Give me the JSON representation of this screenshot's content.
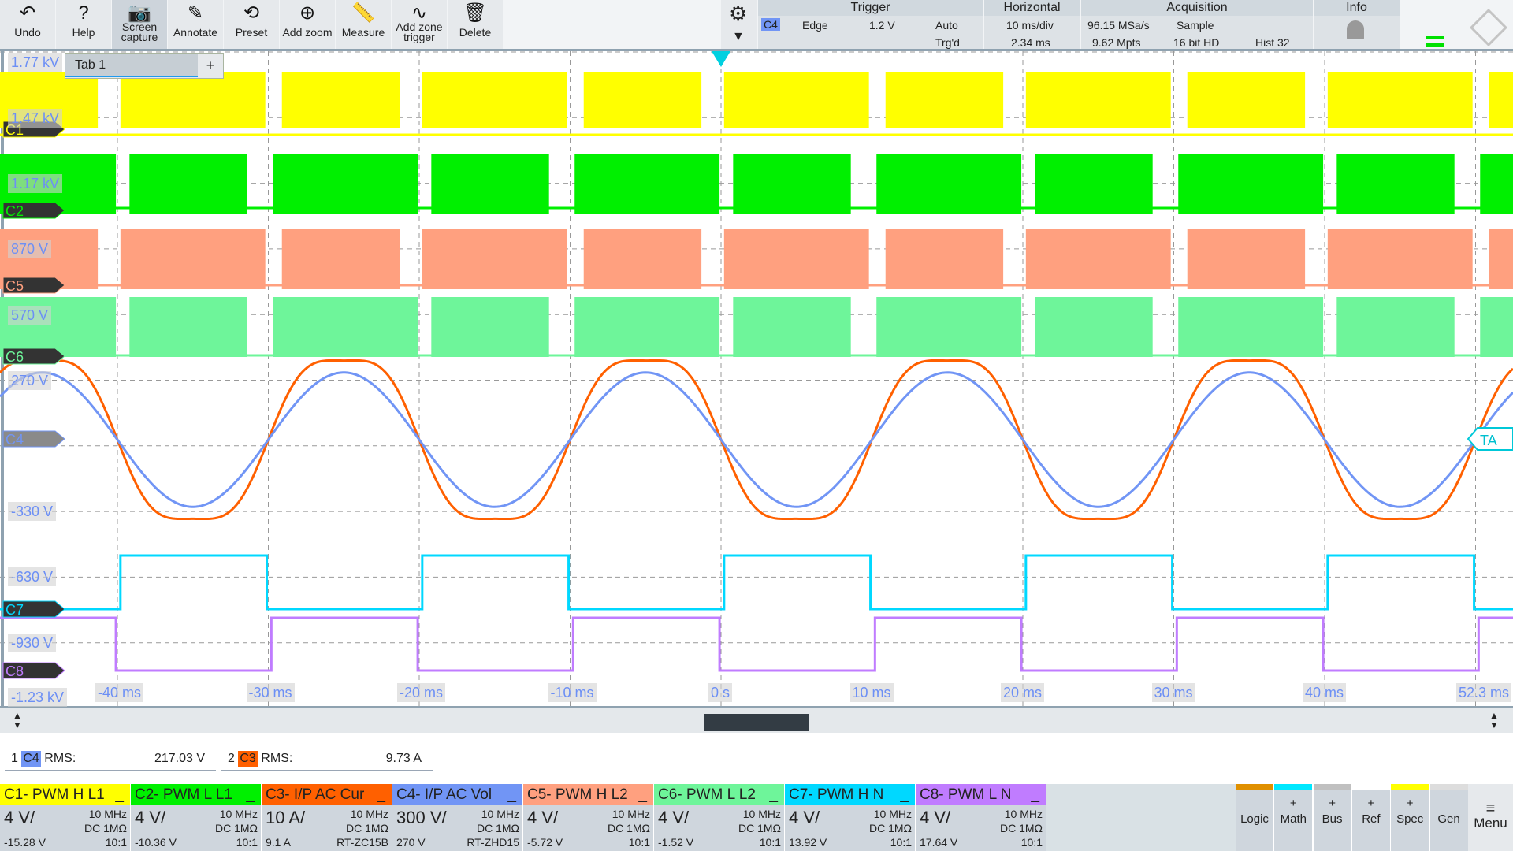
{
  "toolbar": {
    "items": [
      {
        "label": "Undo",
        "icon": "undo-icon",
        "glyph": "↶"
      },
      {
        "label": "Help",
        "icon": "help-icon",
        "glyph": "?"
      },
      {
        "label": "Screen capture",
        "icon": "camera-icon",
        "glyph": "📷"
      },
      {
        "label": "Annotate",
        "icon": "pencil-icon",
        "glyph": "✎"
      },
      {
        "label": "Preset",
        "icon": "preset-icon",
        "glyph": "⟲"
      },
      {
        "label": "Add zoom",
        "icon": "zoom-in-icon",
        "glyph": "⊕"
      },
      {
        "label": "Measure",
        "icon": "ruler-icon",
        "glyph": "📏"
      },
      {
        "label": "Add zone trigger",
        "icon": "zone-trigger-icon",
        "glyph": "∿"
      },
      {
        "label": "Delete",
        "icon": "trash-icon",
        "glyph": "🗑"
      }
    ]
  },
  "trigger": {
    "title": "Trigger",
    "source": "C4",
    "type": "Edge",
    "level": "1.2 V",
    "mode": "Auto",
    "state": "Trg'd"
  },
  "horizontal": {
    "title": "Horizontal",
    "scale": "10 ms/div",
    "position": "2.34 ms"
  },
  "acquisition": {
    "title": "Acquisition",
    "rate": "96.15 MSa/s",
    "points": "9.62 Mpts",
    "mode": "Sample",
    "resolution": "16 bit HD",
    "history": "Hist 32"
  },
  "info": {
    "title": "Info"
  },
  "tabs": [
    {
      "label": "Tab 1"
    }
  ],
  "tab_add": "+",
  "trigger_marker": "TA",
  "chart_data": {
    "type": "line",
    "x_unit": "ms",
    "xlim": [
      -47.7,
      52.3
    ],
    "x_ticks": [
      "-40 ms",
      "-30 ms",
      "-20 ms",
      "-10 ms",
      "0 s",
      "10 ms",
      "20 ms",
      "30 ms",
      "40 ms",
      "52.3 ms"
    ],
    "y_ticks": [
      "1.77 kV",
      "1.47 kV",
      "1.17 kV",
      "870 V",
      "570 V",
      "270 V",
      "-330 V",
      "-630 V",
      "-930 V",
      "-1.23 kV"
    ],
    "grid": true,
    "channels": [
      {
        "id": "C1",
        "color": "#ffff00",
        "kind": "pwm",
        "period_ms": 20,
        "high_ms": [
          [
            0.2,
            9.8
          ],
          [
            10.9,
            18.7
          ]
        ]
      },
      {
        "id": "C2",
        "color": "#00f000",
        "kind": "pwm",
        "period_ms": 20,
        "high_ms": [
          [
            0.8,
            8.6
          ],
          [
            10.3,
            19.9
          ]
        ]
      },
      {
        "id": "C5",
        "color": "#ffa07f",
        "kind": "pwm",
        "period_ms": 20,
        "high_ms": [
          [
            0.2,
            9.8
          ],
          [
            10.9,
            18.7
          ]
        ]
      },
      {
        "id": "C6",
        "color": "#6ef59a",
        "kind": "pwm",
        "period_ms": 20,
        "high_ms": [
          [
            0.8,
            8.6
          ],
          [
            10.3,
            19.9
          ]
        ]
      },
      {
        "id": "C3",
        "color": "#ff6000",
        "kind": "sine",
        "freq_hz": 50,
        "peak": 13.7,
        "unit": "A",
        "zero_cross_falling_ms": -40
      },
      {
        "id": "C4",
        "color": "#7195f5",
        "kind": "sine",
        "freq_hz": 50,
        "peak": 307,
        "unit": "V",
        "zero_cross_falling_ms": -40
      },
      {
        "id": "C7",
        "color": "#00d8ff",
        "kind": "pulse",
        "period_ms": 20,
        "high_ms": [
          [
            0.2,
            9.9
          ]
        ]
      },
      {
        "id": "C8",
        "color": "#c07cff",
        "kind": "pulse",
        "period_ms": 20,
        "high_ms": [
          [
            10.2,
            19.9
          ]
        ]
      }
    ]
  },
  "measurements": [
    {
      "index": "1",
      "source": "C4",
      "source_color": "#7195f5",
      "name": "RMS:",
      "value": "217.03 V"
    },
    {
      "index": "2",
      "source": "C3",
      "source_color": "#ff6000",
      "name": "RMS:",
      "value": "9.73 A"
    }
  ],
  "channel_boxes": [
    {
      "title": "C1- PWM H L1",
      "color": "#ffff00",
      "scale": "4 V/",
      "bw": "10 MHz",
      "coupling": "DC 1MΩ",
      "offset": "-15.28 V",
      "probe": "10:1"
    },
    {
      "title": "C2- PWM L L1",
      "color": "#00f000",
      "scale": "4 V/",
      "bw": "10 MHz",
      "coupling": "DC 1MΩ",
      "offset": "-10.36 V",
      "probe": "10:1"
    },
    {
      "title": "C3- I/P AC Cur",
      "color": "#ff6000",
      "scale": "10 A/",
      "bw": "10 MHz",
      "coupling": "DC 1MΩ",
      "offset": "9.1 A",
      "probe": "RT-ZC15B"
    },
    {
      "title": "C4- I/P AC Vol",
      "color": "#7195f5",
      "scale": "300 V/",
      "bw": "10 MHz",
      "coupling": "DC 1MΩ",
      "offset": "270 V",
      "probe": "RT-ZHD15"
    },
    {
      "title": "C5- PWM H L2",
      "color": "#ffa07f",
      "scale": "4 V/",
      "bw": "10 MHz",
      "coupling": "DC 1MΩ",
      "offset": "-5.72 V",
      "probe": "10:1"
    },
    {
      "title": "C6- PWM L L2",
      "color": "#6ef59a",
      "scale": "4 V/",
      "bw": "10 MHz",
      "coupling": "DC 1MΩ",
      "offset": "-1.52 V",
      "probe": "10:1"
    },
    {
      "title": "C7- PWM H N",
      "color": "#00d8ff",
      "scale": "4 V/",
      "bw": "10 MHz",
      "coupling": "DC 1MΩ",
      "offset": "13.92 V",
      "probe": "10:1"
    },
    {
      "title": "C8- PWM L N",
      "color": "#c07cff",
      "scale": "4 V/",
      "bw": "10 MHz",
      "coupling": "DC 1MΩ",
      "offset": "17.64 V",
      "probe": "10:1"
    }
  ],
  "minimize": "_",
  "right_buttons": [
    {
      "label": "Logic",
      "plus": "",
      "color": "#e09000"
    },
    {
      "label": "Math",
      "plus": "+",
      "color": "#00e8ff"
    },
    {
      "label": "Bus",
      "plus": "+",
      "color": "#c0c0c0"
    },
    {
      "label": "Ref",
      "plus": "+",
      "color": "#ffffff"
    },
    {
      "label": "Spec",
      "plus": "+",
      "color": "#ffff00"
    },
    {
      "label": "Gen",
      "plus": "",
      "color": "#dddddd"
    }
  ],
  "menu_label": "Menu"
}
